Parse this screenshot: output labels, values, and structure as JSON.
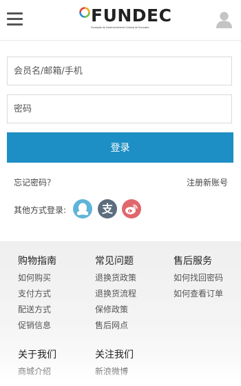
{
  "header": {
    "logo_text": "FUNDEC",
    "logo_subtitle": "Fundação de Desenvolvimento Cultural de Sorocaba",
    "menu_icon": "hamburger-menu-icon",
    "user_icon": "user-icon"
  },
  "form": {
    "username_placeholder": "会员名/邮箱/手机",
    "password_placeholder": "密码",
    "login_label": "登录",
    "forgot_label": "忘记密码？",
    "register_label": "注册新账号",
    "other_login_label": "其他方式登录:"
  },
  "social": [
    {
      "name": "qq",
      "icon": "qq-icon",
      "color": "#5fb4d9"
    },
    {
      "name": "alipay",
      "icon": "alipay-icon",
      "color": "#5b6d7e"
    },
    {
      "name": "weibo",
      "icon": "weibo-icon",
      "color": "#e0676d"
    }
  ],
  "footer": {
    "columns": [
      {
        "title": "购物指南",
        "items": [
          "如何购买",
          "支付方式",
          "配送方式",
          "促销信息"
        ]
      },
      {
        "title": "常见问题",
        "items": [
          "退换货政策",
          "退换货流程",
          "保修政策",
          "售后网点"
        ]
      },
      {
        "title": "售后服务",
        "items": [
          "如何找回密码",
          "如何查看订单"
        ]
      },
      {
        "title": "关于我们",
        "items": [
          "商城介绍"
        ]
      },
      {
        "title": "关注我们",
        "items": [
          "新浪微博"
        ]
      }
    ]
  },
  "colors": {
    "primary": "#1e8fc4",
    "footer_bg": "#efefef"
  }
}
